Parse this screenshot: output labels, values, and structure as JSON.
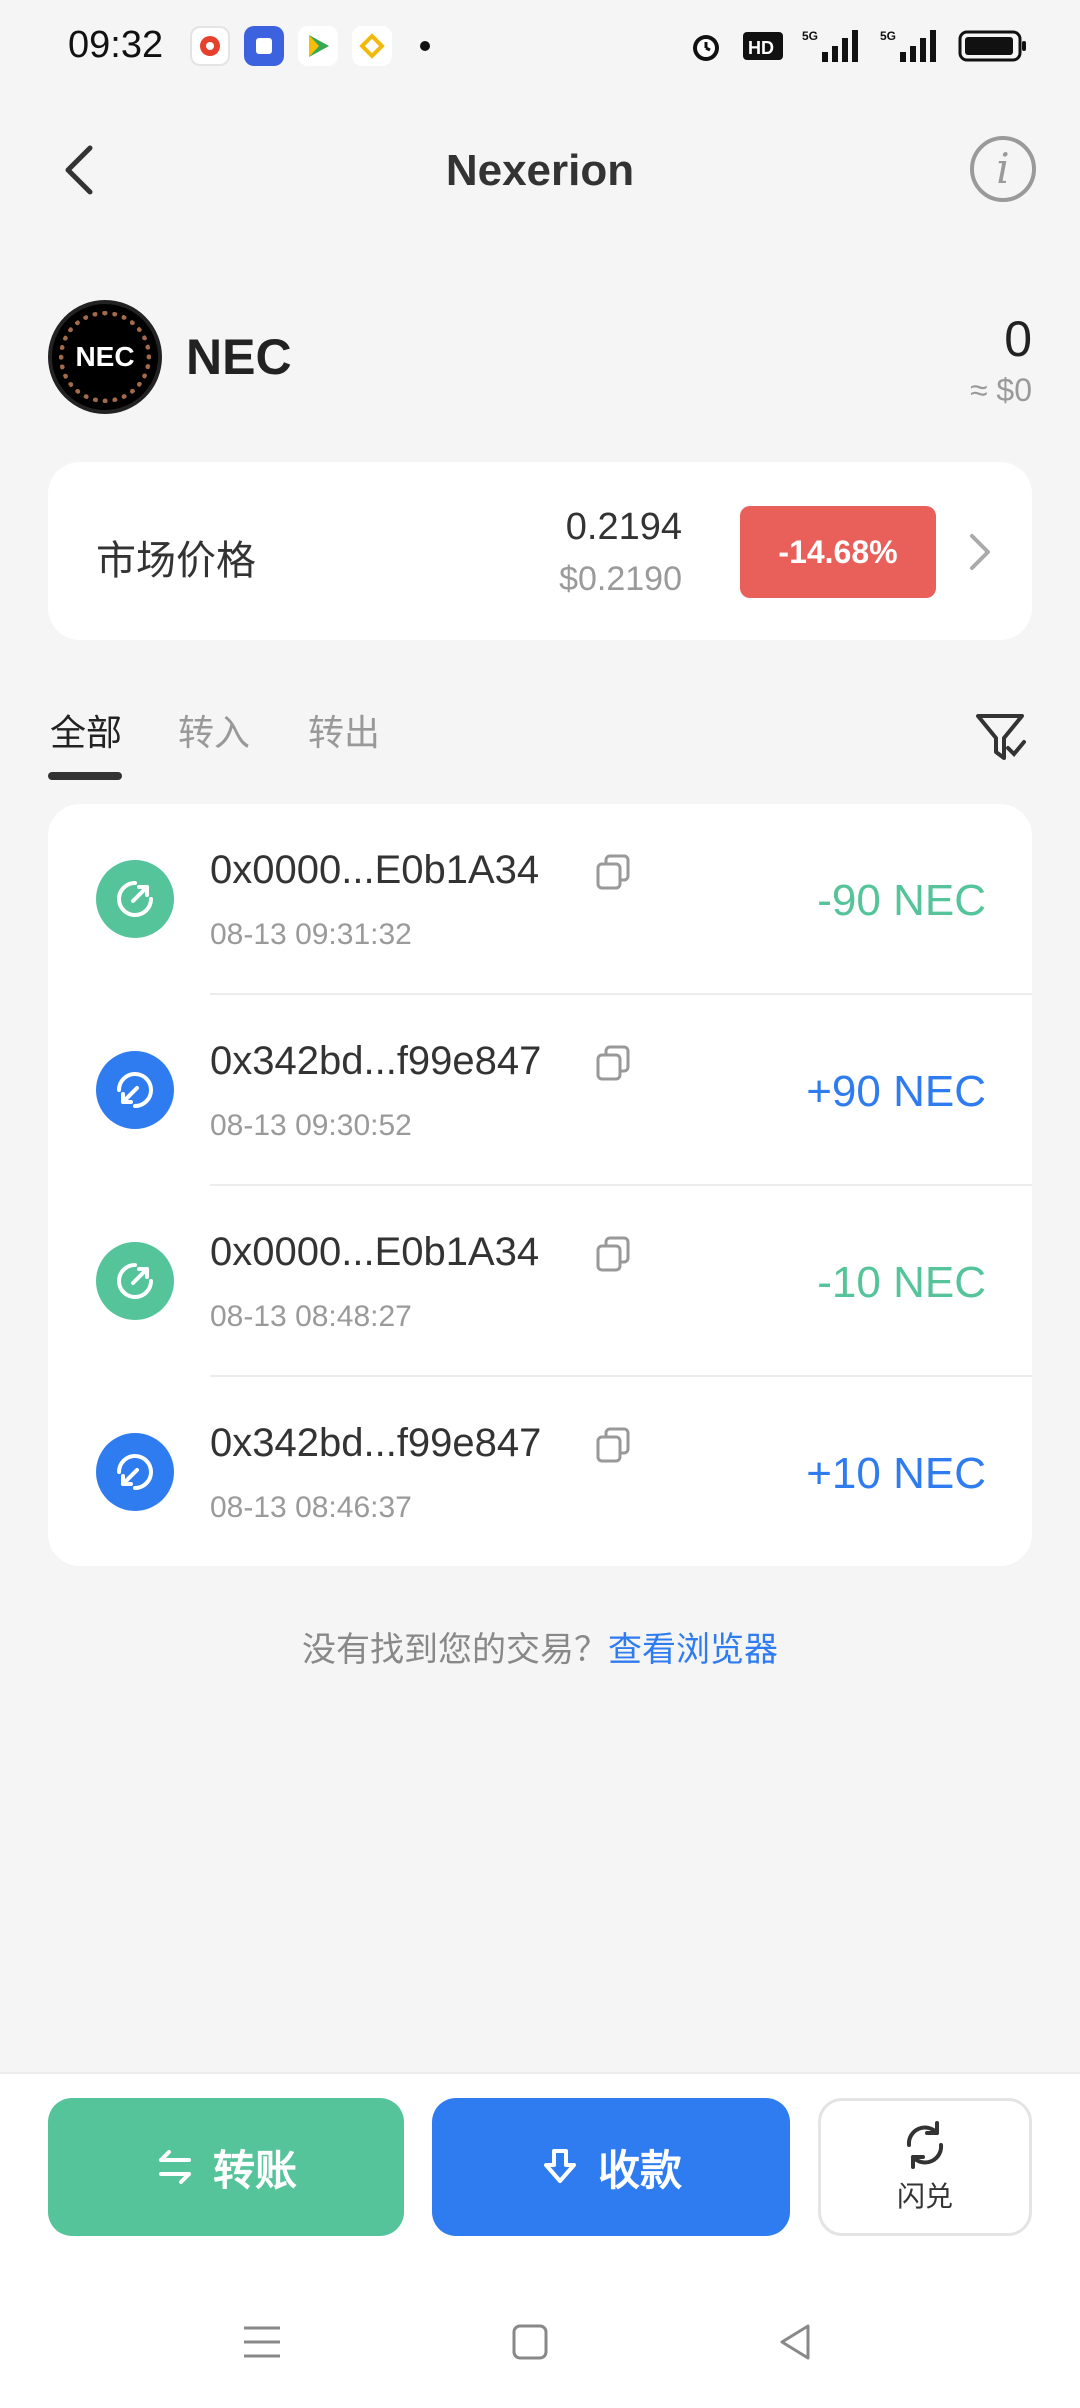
{
  "status_bar": {
    "time": "09:32",
    "icons": [
      "alarm-icon",
      "hd-icon",
      "signal-5g-icon",
      "signal-5g-icon",
      "battery-icon"
    ]
  },
  "header": {
    "title": "Nexerion"
  },
  "token": {
    "symbol": "NEC",
    "logo_text": "NEC",
    "balance": "0",
    "fiat_balance": "≈ $0"
  },
  "market": {
    "label": "市场价格",
    "price": "0.2194",
    "price_usd": "$0.2190",
    "change": "-14.68%",
    "change_color": "#e9605a"
  },
  "tabs": [
    {
      "label": "全部",
      "active": true
    },
    {
      "label": "转入",
      "active": false
    },
    {
      "label": "转出",
      "active": false
    }
  ],
  "transactions": [
    {
      "direction": "out",
      "address": "0x0000...E0b1A34",
      "time": "08-13 09:31:32",
      "amount": "-90 NEC"
    },
    {
      "direction": "in",
      "address": "0x342bd...f99e847",
      "time": "08-13 09:30:52",
      "amount": "+90 NEC"
    },
    {
      "direction": "out",
      "address": "0x0000...E0b1A34",
      "time": "08-13 08:48:27",
      "amount": "-10 NEC"
    },
    {
      "direction": "in",
      "address": "0x342bd...f99e847",
      "time": "08-13 08:46:37",
      "amount": "+10 NEC"
    }
  ],
  "explorer": {
    "prompt": "没有找到您的交易？",
    "link": "查看浏览器"
  },
  "actions": {
    "transfer": "转账",
    "receive": "收款",
    "swap": "闪兑"
  },
  "colors": {
    "out": "#55c49a",
    "in": "#2f7cf0",
    "background": "#f5f5f6"
  }
}
